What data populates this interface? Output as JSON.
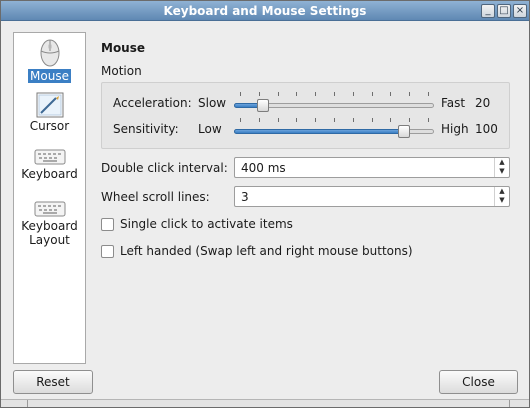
{
  "window": {
    "title": "Keyboard and Mouse Settings",
    "controls": [
      "minimize-icon",
      "maximize-icon",
      "close-icon"
    ]
  },
  "sidebar": {
    "items": [
      {
        "label": "Mouse",
        "icon": "mouse-icon",
        "selected": true
      },
      {
        "label": "Cursor",
        "icon": "cursor-icon",
        "selected": false
      },
      {
        "label": "Keyboard",
        "icon": "keyboard-icon",
        "selected": false
      },
      {
        "label": "Keyboard Layout",
        "label_lines": [
          "Keyboard",
          "Layout"
        ],
        "icon": "keyboard-layout-icon",
        "selected": false
      }
    ]
  },
  "main": {
    "section_title": "Mouse",
    "motion": {
      "label": "Motion",
      "acceleration": {
        "label": "Acceleration:",
        "min_label": "Slow",
        "max_label": "Fast",
        "value": "20",
        "position": 0.12
      },
      "sensitivity": {
        "label": "Sensitivity:",
        "min_label": "Low",
        "max_label": "High",
        "value": "100",
        "position": 0.87
      }
    },
    "double_click": {
      "label": "Double click interval:",
      "value": "400 ms"
    },
    "wheel_scroll": {
      "label": "Wheel scroll lines:",
      "value": "3"
    },
    "single_click": {
      "label": "Single click to activate items",
      "checked": false
    },
    "left_handed": {
      "label": "Left handed (Swap left and right mouse buttons)",
      "checked": false
    }
  },
  "buttons": {
    "reset": "Reset",
    "close": "Close"
  },
  "colors": {
    "title_bar": "#5f88b3",
    "selection": "#3b7fc4",
    "slider_fill": "#3b7fc4"
  }
}
